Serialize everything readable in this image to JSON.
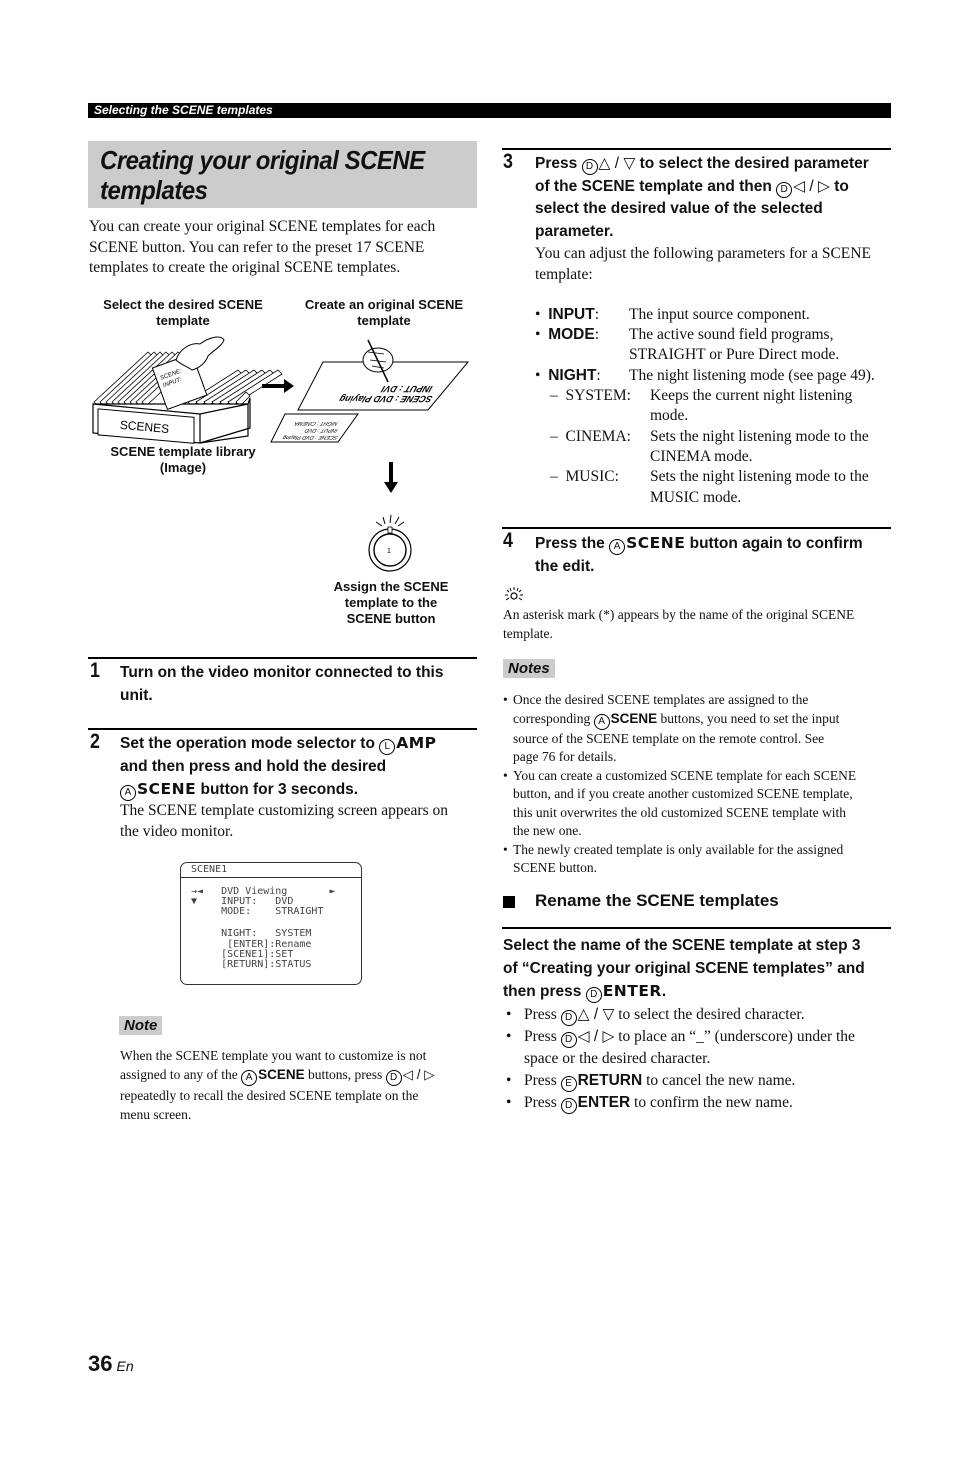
{
  "header": {
    "section_title": "Selecting the SCENE templates"
  },
  "title": {
    "line1": "Creating your original SCENE",
    "line2": "templates"
  },
  "intro": {
    "lines": [
      "You can create your original SCENE templates for each",
      "SCENE button. You can refer to the preset 17 SCENE",
      "templates to create the original SCENE templates."
    ]
  },
  "figure": {
    "select_label": [
      "Select the desired SCENE",
      "template"
    ],
    "create_label": [
      "Create an original SCENE",
      "template"
    ],
    "library_label": [
      "SCENE template library",
      "(Image)"
    ],
    "assign_label": [
      "Assign the SCENE",
      "template to the",
      "SCENE button"
    ],
    "box_label": "SCENES",
    "card_text": [
      "SCENE:",
      "INPUT:"
    ],
    "big_sheet": [
      "INPUT : DVI",
      "SCENE : DVD Playing"
    ],
    "small_sheet": [
      "NIGHT : CINEMA",
      "INPUT : DVD",
      "SCENE : DVD Playing"
    ],
    "button_number": "1"
  },
  "steps": {
    "s1": {
      "num": "1",
      "lines": [
        "Turn on the video monitor connected to this",
        "unit."
      ]
    },
    "s2": {
      "num": "2",
      "line1_pre": "Set the operation mode selector to ",
      "line1_key_letter": "L",
      "line1_key": "AMP",
      "line2": "and then press and hold the desired",
      "line3_key_letter": "A",
      "line3_key": "SCENE",
      "line3_post": " button for 3 seconds.",
      "body": [
        "The SCENE template customizing screen appears on",
        "the video monitor."
      ]
    },
    "s3": {
      "num": "3",
      "l1_pre": "Press ",
      "l1_key_letter": "D",
      "l1_arrows": "△ / ▽",
      "l1_post": " to select the desired parameter",
      "l2_pre": "of the SCENE template and then ",
      "l2_key_letter": "D",
      "l2_arrows": "◁ / ▷",
      "l2_post": " to",
      "l3": "select the desired value of the selected",
      "l4": "parameter.",
      "body": [
        "You can adjust the following parameters for a SCENE",
        "template:"
      ]
    },
    "s4": {
      "num": "4",
      "l1_pre": "Press the ",
      "key_letter": "A",
      "key": "SCENE",
      "l1_post": " button again to confirm",
      "l2": "the edit."
    }
  },
  "screen": {
    "title": "SCENE1",
    "lines": [
      "→◄   DVD Viewing       ►",
      "▼    INPUT:   DVD",
      "     MODE:    STRAIGHT",
      "",
      "     NIGHT:   SYSTEM",
      "      [ENTER]:Rename",
      "     [SCENE1]:SET",
      "     [RETURN]:STATUS"
    ]
  },
  "note": {
    "tag": "Note",
    "l1": "When the SCENE template you want to customize is not",
    "l2_pre": "assigned to any of the ",
    "l2_key_letter": "A",
    "l2_key": "SCENE",
    "l2_mid": " buttons, press ",
    "l2_key2_letter": "D",
    "l2_arrows": "◁ / ▷",
    "l3": "repeatedly to recall the desired SCENE template on the",
    "l4": "menu screen."
  },
  "parameters": [
    {
      "key": "INPUT",
      "desc": [
        "The input source component."
      ]
    },
    {
      "key": "MODE",
      "desc": [
        "The active sound field programs,",
        "STRAIGHT or Pure Direct mode."
      ]
    },
    {
      "key": "NIGHT",
      "desc": [
        "The night listening mode (see page 49)."
      ]
    }
  ],
  "night_options": [
    {
      "key": "SYSTEM:",
      "desc": [
        "Keeps the current night listening",
        "mode."
      ]
    },
    {
      "key": "CINEMA:",
      "desc": [
        "Sets the night listening mode to the",
        "CINEMA mode."
      ]
    },
    {
      "key": "MUSIC:",
      "desc": [
        "Sets the night listening mode to the",
        "MUSIC mode."
      ]
    }
  ],
  "tip": {
    "icon": "tip-icon",
    "lines": [
      "An asterisk mark (*) appears by the name of the original SCENE",
      "template."
    ]
  },
  "notes": {
    "tag": "Notes",
    "items": [
      {
        "pre": "Once the desired SCENE templates are assigned to the",
        "l2_pre": "corresponding ",
        "key_letter": "A",
        "key": "SCENE",
        "l2_post": " buttons, you need to set the input",
        "rest": [
          "source of the SCENE template on the remote control. See",
          "page 76 for details."
        ]
      },
      {
        "lines": [
          "You can create a customized SCENE template for each SCENE",
          "button, and if you create another customized SCENE template,",
          "this unit overwrites the old customized SCENE template with",
          "the new one."
        ]
      },
      {
        "lines": [
          "The newly created template is only available for the assigned",
          "SCENE button."
        ]
      }
    ]
  },
  "rename": {
    "heading": "Rename the SCENE templates",
    "instr_l1": "Select the name of the SCENE template at step 3",
    "instr_l2": "of “Creating your original SCENE templates” and",
    "instr_l3_pre": "then press ",
    "instr_key_letter": "D",
    "instr_key": "ENTER",
    "instr_l3_post": ".",
    "items": [
      {
        "pre": "Press ",
        "key_letter": "D",
        "arrows": "△ / ▽",
        "post": " to select the desired character."
      },
      {
        "pre": "Press ",
        "key_letter": "D",
        "arrows": "◁ / ▷",
        "post": " to place an “_” (underscore) under the",
        "l2": "space or the desired character."
      },
      {
        "pre": "Press ",
        "key_letter": "E",
        "key": "RETURN",
        "post": " to cancel the new name."
      },
      {
        "pre": "Press ",
        "key_letter": "D",
        "key": "ENTER",
        "post": " to confirm the new name."
      }
    ]
  },
  "footer": {
    "page_number": "36",
    "lang": "En"
  }
}
